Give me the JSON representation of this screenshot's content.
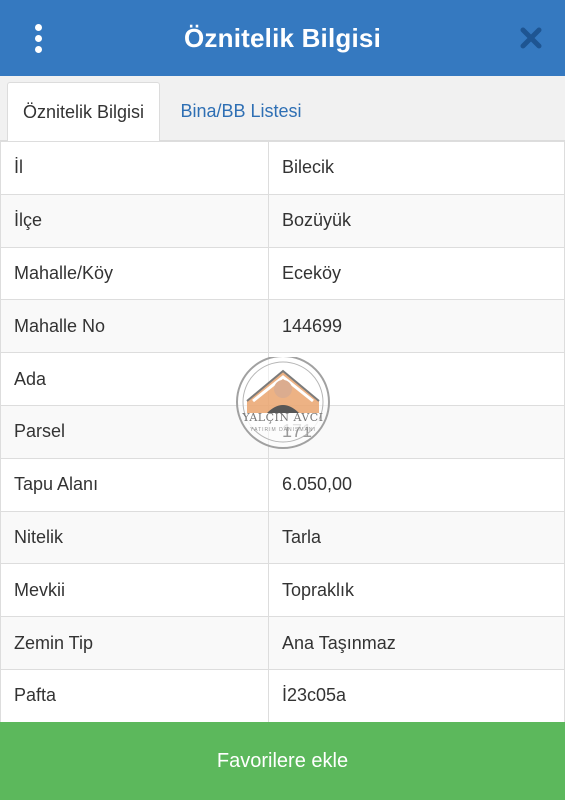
{
  "header": {
    "title": "Öznitelik Bilgisi",
    "menu_icon": "kebab-menu-icon",
    "close_icon": "close-icon",
    "background": "#3579c0"
  },
  "tabs": [
    {
      "label": "Öznitelik Bilgisi",
      "active": true
    },
    {
      "label": "Bina/BB Listesi",
      "active": false
    }
  ],
  "attributes": [
    {
      "key": "İl",
      "value": "Bilecik"
    },
    {
      "key": "İlçe",
      "value": "Bozüyük"
    },
    {
      "key": "Mahalle/Köy",
      "value": "Eceköy"
    },
    {
      "key": "Mahalle No",
      "value": "144699"
    },
    {
      "key": "Ada",
      "value": ""
    },
    {
      "key": "Parsel",
      "value": "171"
    },
    {
      "key": "Tapu Alanı",
      "value": "6.050,00"
    },
    {
      "key": "Nitelik",
      "value": "Tarla"
    },
    {
      "key": "Mevkii",
      "value": "Topraklık"
    },
    {
      "key": "Zemin Tip",
      "value": "Ana Taşınmaz"
    },
    {
      "key": "Pafta",
      "value": "İ23c05a"
    }
  ],
  "watermark": {
    "name": "YALÇIN AVCI",
    "tagline": "YATIRIM DANIŞMANI"
  },
  "footer": {
    "button_label": "Favorilere ekle",
    "color": "#5cb85c"
  }
}
